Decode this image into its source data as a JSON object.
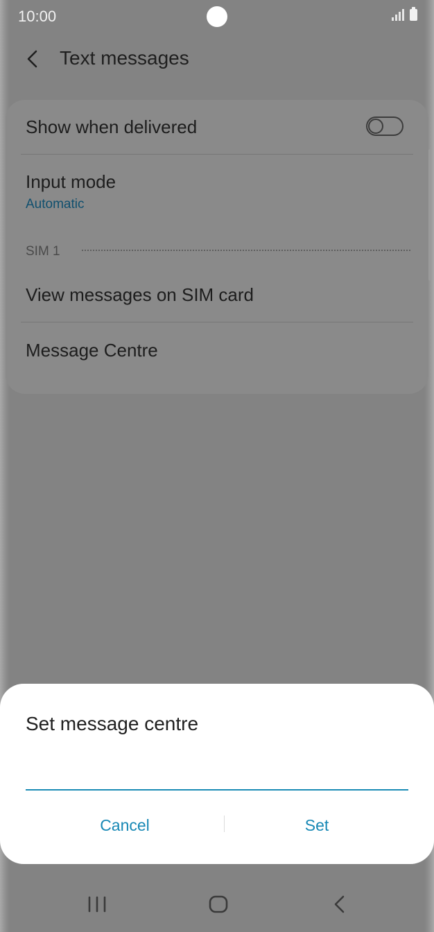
{
  "status_bar": {
    "time": "10:00",
    "icons": [
      "signal-icon",
      "battery-icon"
    ]
  },
  "header": {
    "title": "Text messages",
    "back_icon": "back-arrow-icon"
  },
  "settings": {
    "show_when_delivered": {
      "label": "Show when delivered",
      "toggle_on": false
    },
    "input_mode": {
      "label": "Input mode",
      "value": "Automatic"
    },
    "section_label": "SIM 1",
    "view_messages": {
      "label": "View messages on SIM card"
    },
    "message_centre": {
      "label": "Message Centre"
    }
  },
  "dialog": {
    "title": "Set message centre",
    "input_value": "",
    "cancel_label": "Cancel",
    "set_label": "Set"
  },
  "nav_bar": {
    "icons": [
      "recents-icon",
      "home-icon",
      "back-icon"
    ]
  },
  "colors": {
    "accent": "#1788b5",
    "dim_overlay_background": "#838383",
    "dialog_background": "#ffffff"
  }
}
